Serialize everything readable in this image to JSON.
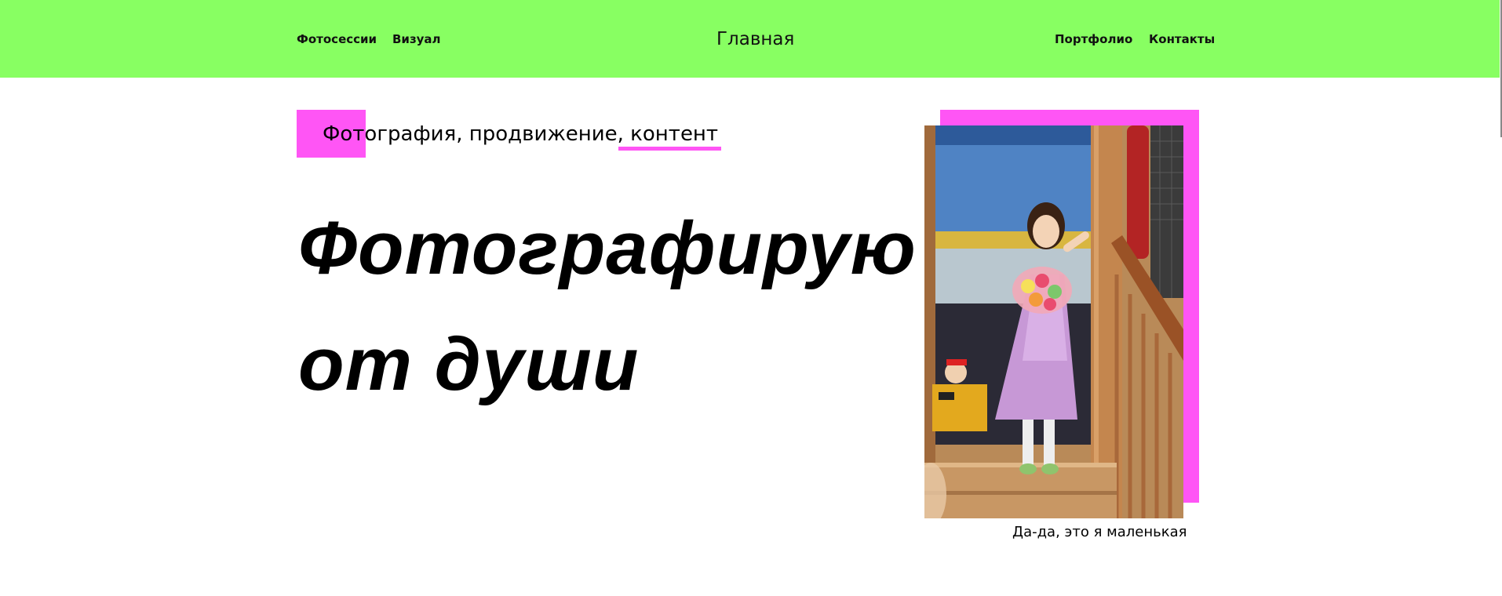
{
  "nav": {
    "left": [
      "Фотосессии",
      "Визуал"
    ],
    "home": "Главная",
    "right": [
      "Портфолио",
      "Контакты"
    ]
  },
  "hero": {
    "tagline": "Фотография, продвижение, контент",
    "headline_line1": "Фотографирую",
    "headline_line2": "от души"
  },
  "photo": {
    "caption": "Да-да, это я маленькая"
  },
  "colors": {
    "header_bg": "#88ff62",
    "accent": "#ff55f5"
  }
}
